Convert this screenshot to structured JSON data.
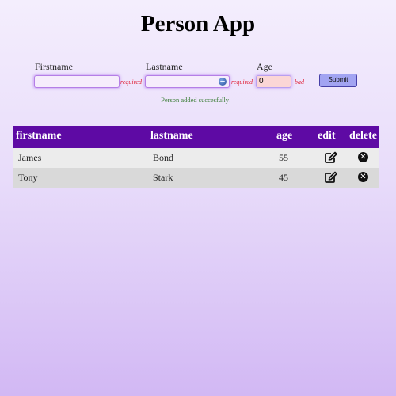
{
  "app": {
    "title": "Person App"
  },
  "form": {
    "firstname": {
      "label": "Firstname",
      "value": "",
      "hint": "required"
    },
    "lastname": {
      "label": "Lastname",
      "value": "",
      "hint": "required"
    },
    "age": {
      "label": "Age",
      "value": "0",
      "hint": "bad"
    },
    "submit_label": "Submit",
    "success_message": "Person added succesfully!"
  },
  "table": {
    "headers": {
      "firstname": "firstname",
      "lastname": "lastname",
      "age": "age",
      "edit": "edit",
      "delete": "delete"
    },
    "rows": [
      {
        "firstname": "James",
        "lastname": "Bond",
        "age": "55"
      },
      {
        "firstname": "Tony",
        "lastname": "Stark",
        "age": "45"
      }
    ]
  },
  "icons": {
    "edit": "edit-icon",
    "delete": "delete-circle-x-icon",
    "autofill": "globe-icon"
  },
  "colors": {
    "header_bg": "#5e0aa4",
    "button_bg": "#a2a4f2",
    "error": "#e0233a",
    "success": "#3b7d36"
  }
}
